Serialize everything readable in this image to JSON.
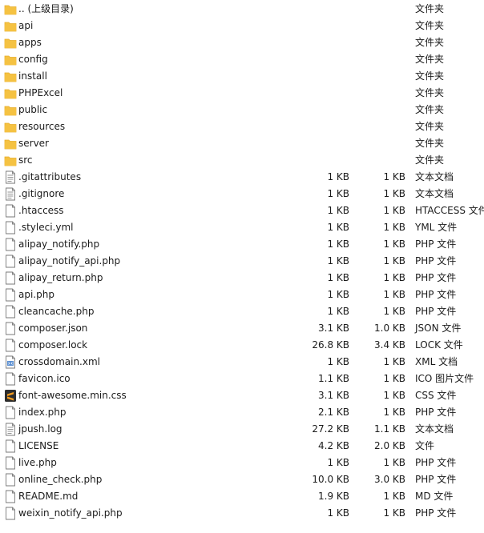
{
  "colors": {
    "folder": "#f5c242",
    "folder_tab": "#e8ad2a",
    "file_outline": "#7a7a7a",
    "sublime_bg": "#2d2d2d",
    "sublime_s": "#f59b1d"
  },
  "files": [
    {
      "name": ".. (上级目录)",
      "size": "",
      "packed": "",
      "type": "文件夹",
      "icon": "folder-icon"
    },
    {
      "name": "api",
      "size": "",
      "packed": "",
      "type": "文件夹",
      "icon": "folder-icon"
    },
    {
      "name": "apps",
      "size": "",
      "packed": "",
      "type": "文件夹",
      "icon": "folder-icon"
    },
    {
      "name": "config",
      "size": "",
      "packed": "",
      "type": "文件夹",
      "icon": "folder-icon"
    },
    {
      "name": "install",
      "size": "",
      "packed": "",
      "type": "文件夹",
      "icon": "folder-icon"
    },
    {
      "name": "PHPExcel",
      "size": "",
      "packed": "",
      "type": "文件夹",
      "icon": "folder-icon"
    },
    {
      "name": "public",
      "size": "",
      "packed": "",
      "type": "文件夹",
      "icon": "folder-icon"
    },
    {
      "name": "resources",
      "size": "",
      "packed": "",
      "type": "文件夹",
      "icon": "folder-icon"
    },
    {
      "name": "server",
      "size": "",
      "packed": "",
      "type": "文件夹",
      "icon": "folder-icon"
    },
    {
      "name": "src",
      "size": "",
      "packed": "",
      "type": "文件夹",
      "icon": "folder-icon"
    },
    {
      "name": ".gitattributes",
      "size": "1 KB",
      "packed": "1 KB",
      "type": "文本文档",
      "icon": "text-file-icon"
    },
    {
      "name": ".gitignore",
      "size": "1 KB",
      "packed": "1 KB",
      "type": "文本文档",
      "icon": "text-file-icon"
    },
    {
      "name": ".htaccess",
      "size": "1 KB",
      "packed": "1 KB",
      "type": "HTACCESS 文件",
      "icon": "file-icon"
    },
    {
      "name": ".styleci.yml",
      "size": "1 KB",
      "packed": "1 KB",
      "type": "YML 文件",
      "icon": "file-icon"
    },
    {
      "name": "alipay_notify.php",
      "size": "1 KB",
      "packed": "1 KB",
      "type": "PHP 文件",
      "icon": "file-icon"
    },
    {
      "name": "alipay_notify_api.php",
      "size": "1 KB",
      "packed": "1 KB",
      "type": "PHP 文件",
      "icon": "file-icon"
    },
    {
      "name": "alipay_return.php",
      "size": "1 KB",
      "packed": "1 KB",
      "type": "PHP 文件",
      "icon": "file-icon"
    },
    {
      "name": "api.php",
      "size": "1 KB",
      "packed": "1 KB",
      "type": "PHP 文件",
      "icon": "file-icon"
    },
    {
      "name": "cleancache.php",
      "size": "1 KB",
      "packed": "1 KB",
      "type": "PHP 文件",
      "icon": "file-icon"
    },
    {
      "name": "composer.json",
      "size": "3.1 KB",
      "packed": "1.0 KB",
      "type": "JSON 文件",
      "icon": "file-icon"
    },
    {
      "name": "composer.lock",
      "size": "26.8 KB",
      "packed": "3.4 KB",
      "type": "LOCK 文件",
      "icon": "file-icon"
    },
    {
      "name": "crossdomain.xml",
      "size": "1 KB",
      "packed": "1 KB",
      "type": "XML 文档",
      "icon": "xml-file-icon"
    },
    {
      "name": "favicon.ico",
      "size": "1.1 KB",
      "packed": "1 KB",
      "type": "ICO 图片文件",
      "icon": "file-icon"
    },
    {
      "name": "font-awesome.min.css",
      "size": "3.1 KB",
      "packed": "1 KB",
      "type": "CSS 文件",
      "icon": "sublime-icon"
    },
    {
      "name": "index.php",
      "size": "2.1 KB",
      "packed": "1 KB",
      "type": "PHP 文件",
      "icon": "file-icon"
    },
    {
      "name": "jpush.log",
      "size": "27.2 KB",
      "packed": "1.1 KB",
      "type": "文本文档",
      "icon": "text-file-icon"
    },
    {
      "name": "LICENSE",
      "size": "4.2 KB",
      "packed": "2.0 KB",
      "type": "文件",
      "icon": "file-icon"
    },
    {
      "name": "live.php",
      "size": "1 KB",
      "packed": "1 KB",
      "type": "PHP 文件",
      "icon": "file-icon"
    },
    {
      "name": "online_check.php",
      "size": "10.0 KB",
      "packed": "3.0 KB",
      "type": "PHP 文件",
      "icon": "file-icon"
    },
    {
      "name": "README.md",
      "size": "1.9 KB",
      "packed": "1 KB",
      "type": "MD 文件",
      "icon": "file-icon"
    },
    {
      "name": "weixin_notify_api.php",
      "size": "1 KB",
      "packed": "1 KB",
      "type": "PHP 文件",
      "icon": "file-icon"
    }
  ]
}
